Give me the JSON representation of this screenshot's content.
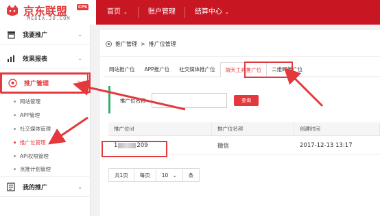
{
  "header": {
    "logo_text": "京东联盟",
    "logo_badge": "CPS",
    "logo_sub": "MEDIA.JD.COM",
    "nav": [
      {
        "label": "首页",
        "has_chevron": true
      },
      {
        "label": "账户管理",
        "has_chevron": false
      },
      {
        "label": "结算中心",
        "has_chevron": true
      }
    ]
  },
  "sidebar": {
    "items": [
      {
        "label": "我要推广",
        "icon": "storefront-icon"
      },
      {
        "label": "效果报表",
        "icon": "bar-chart-icon"
      },
      {
        "label": "推广管理",
        "icon": "target-icon"
      },
      {
        "label": "我的推广",
        "icon": "document-icon"
      }
    ],
    "sub_items": [
      {
        "label": "网站管理"
      },
      {
        "label": "APP管理"
      },
      {
        "label": "社交媒体管理"
      },
      {
        "label": "推广位管理"
      },
      {
        "label": "API权限管理"
      },
      {
        "label": "京推计划管理"
      }
    ]
  },
  "main": {
    "breadcrumb": {
      "parent": "推广管理",
      "separator": ">",
      "current": "推广位管理"
    },
    "tabs": [
      {
        "label": "网站推广位"
      },
      {
        "label": "APP推广位"
      },
      {
        "label": "社交媒体推广位"
      },
      {
        "label": "聊天工具推广位"
      },
      {
        "label": "二维码推广位"
      }
    ],
    "filter": {
      "label": "推广位名称",
      "input_value": "",
      "button_label": "查询"
    },
    "table": {
      "headers": [
        "推广位id",
        "推广位名称",
        "创建时间"
      ],
      "rows": [
        {
          "id_prefix": "1",
          "id_suffix": "209",
          "name": "微信",
          "created": "2017-12-13 13:17"
        }
      ]
    },
    "pager": {
      "total": "共1页",
      "per_page_label": "每页",
      "per_page_value": "10",
      "unit": "条"
    }
  },
  "colors": {
    "brand_red": "#c81623",
    "accent_red": "#e4393c",
    "filter_green": "#3caa6e"
  }
}
